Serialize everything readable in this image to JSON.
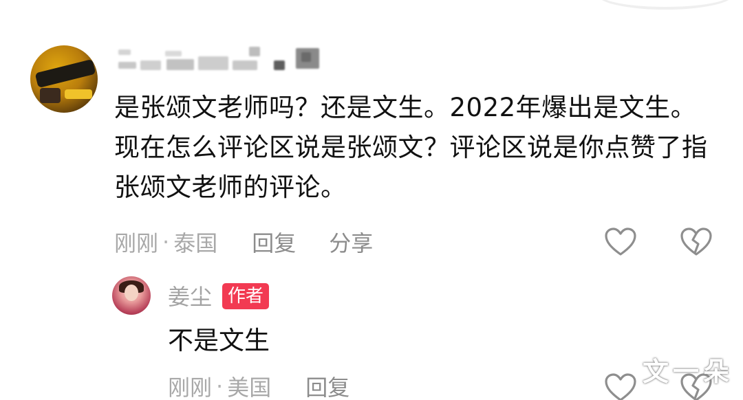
{
  "comment": {
    "text": "是张颂文老师吗？还是文生。2022年爆出是文生。现在怎么评论区说是张颂文？评论区说是你点赞了指张颂文老师的评论。",
    "time": "刚刚",
    "separator": "·",
    "location": "泰国",
    "reply_label": "回复",
    "share_label": "分享"
  },
  "reply": {
    "username": "姜尘",
    "badge": "作者",
    "text": "不是文生",
    "time": "刚刚",
    "separator": "·",
    "location": "美国",
    "reply_label": "回复"
  },
  "icons": {
    "like": "heart-icon",
    "dislike": "broken-heart-icon"
  },
  "colors": {
    "badge": "#f23a52",
    "meta_text": "#a8a8a8",
    "body_text": "#111111"
  },
  "watermarks": {
    "corner": "文一朵"
  }
}
